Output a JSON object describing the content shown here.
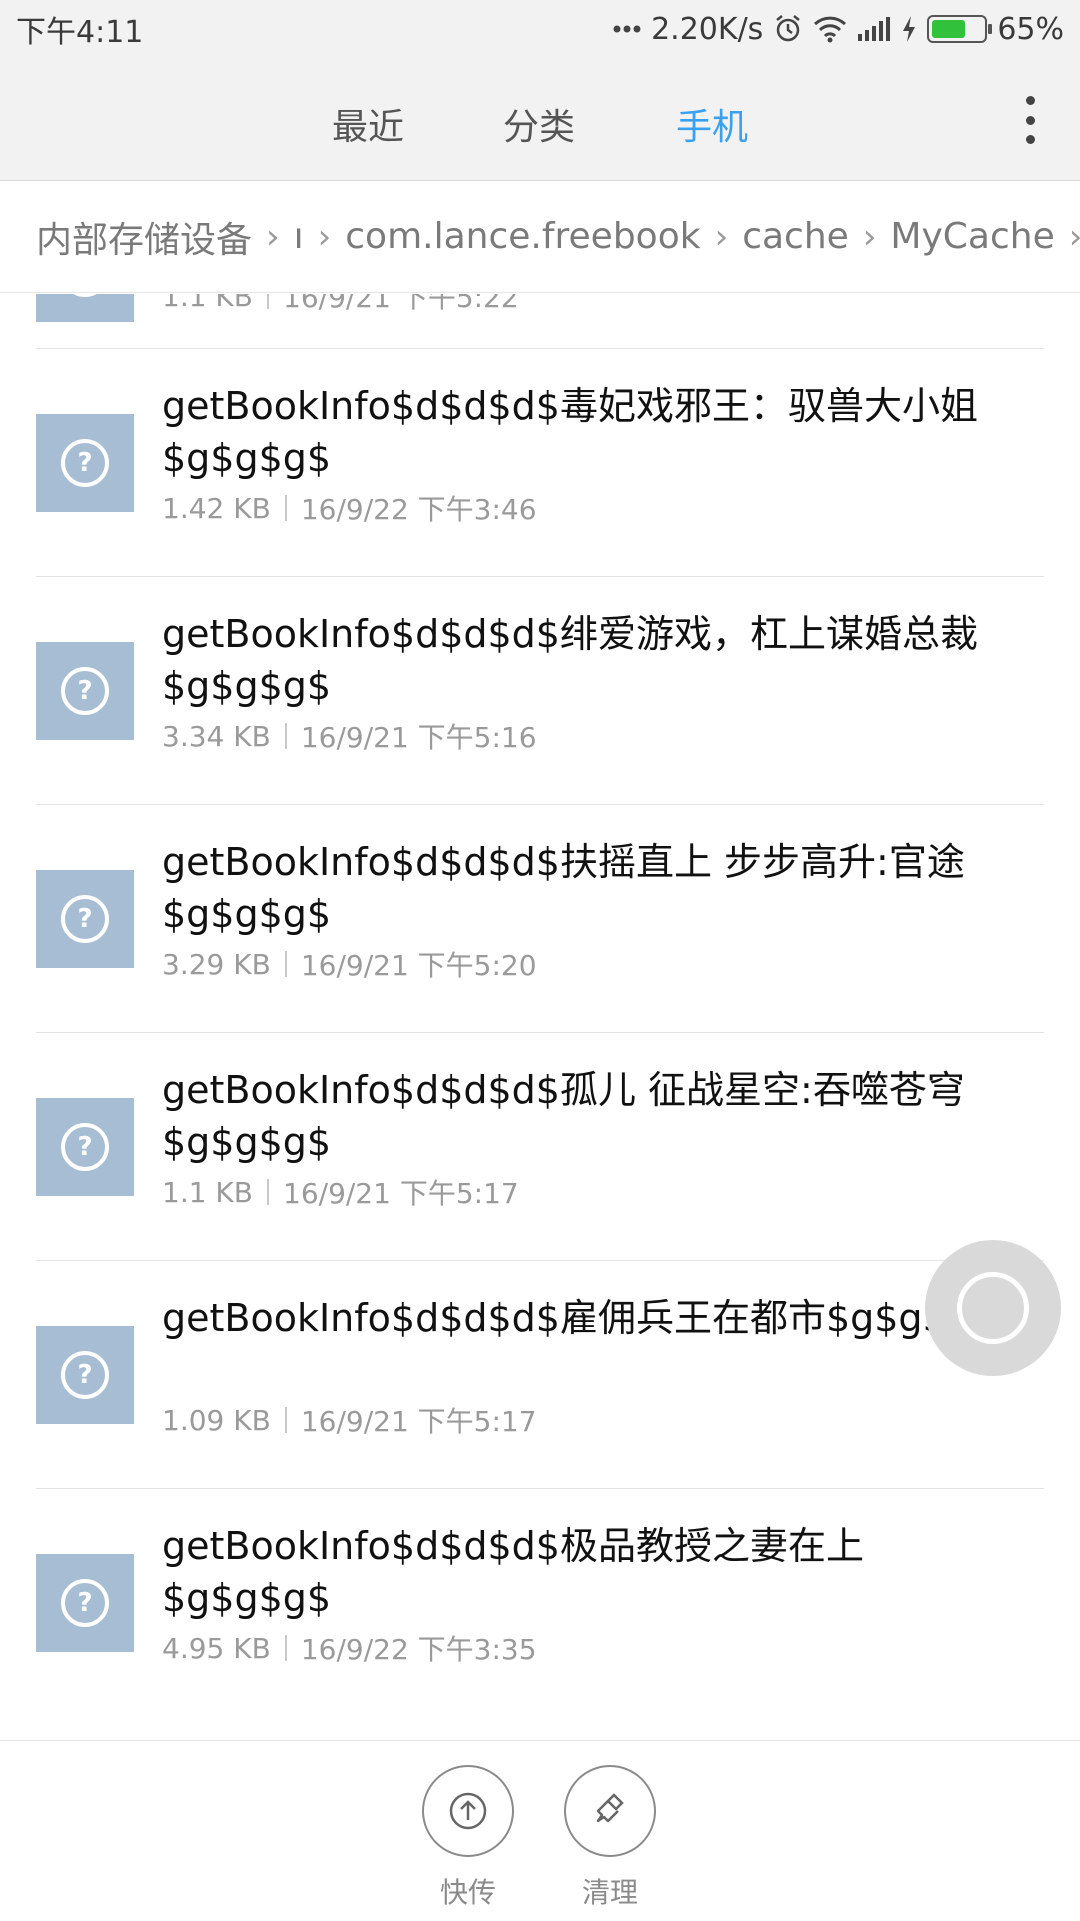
{
  "status_bar": {
    "time": "下午4:11",
    "network_speed": "2.20K/s",
    "battery_percent": "65%",
    "battery_level": 0.65,
    "icons": [
      "more-dots-icon",
      "alarm-icon",
      "wifi-icon",
      "signal-icon",
      "charging-icon",
      "battery-icon"
    ]
  },
  "tabs": [
    {
      "label": "最近"
    },
    {
      "label": "分类"
    },
    {
      "label": "手机"
    }
  ],
  "active_tab": "手机",
  "accent_color": "#3aa1f0",
  "breadcrumb": [
    "内部存储设备",
    "ı",
    "com.lance.freebook",
    "cache",
    "MyCache"
  ],
  "files": [
    {
      "title": "",
      "size": "1.1 KB",
      "date": "16/9/21 下午5:22"
    },
    {
      "title": "getBookInfo$d$d$d$毒妃戏邪王：驭兽大小姐$g$g$g$",
      "size": "1.42 KB",
      "date": "16/9/22 下午3:46"
    },
    {
      "title": "getBookInfo$d$d$d$绯爱游戏，杠上谋婚总裁$g$g$g$",
      "size": "3.34 KB",
      "date": "16/9/21 下午5:16"
    },
    {
      "title": "getBookInfo$d$d$d$扶摇直上 步步高升:官途$g$g$g$",
      "size": "3.29 KB",
      "date": "16/9/21 下午5:20"
    },
    {
      "title": "getBookInfo$d$d$d$孤儿 征战星空:吞噬苍穹$g$g$g$",
      "size": "1.1 KB",
      "date": "16/9/21 下午5:17"
    },
    {
      "title": "getBookInfo$d$d$d$雇佣兵王在都市$g$g$g$",
      "size": "1.09 KB",
      "date": "16/9/21 下午5:17"
    },
    {
      "title": "getBookInfo$d$d$d$极品教授之妻在上$g$g$g$",
      "size": "4.95 KB",
      "date": "16/9/22 下午3:35"
    }
  ],
  "bottom_bar": {
    "quick_transfer": "快传",
    "clean": "清理"
  }
}
